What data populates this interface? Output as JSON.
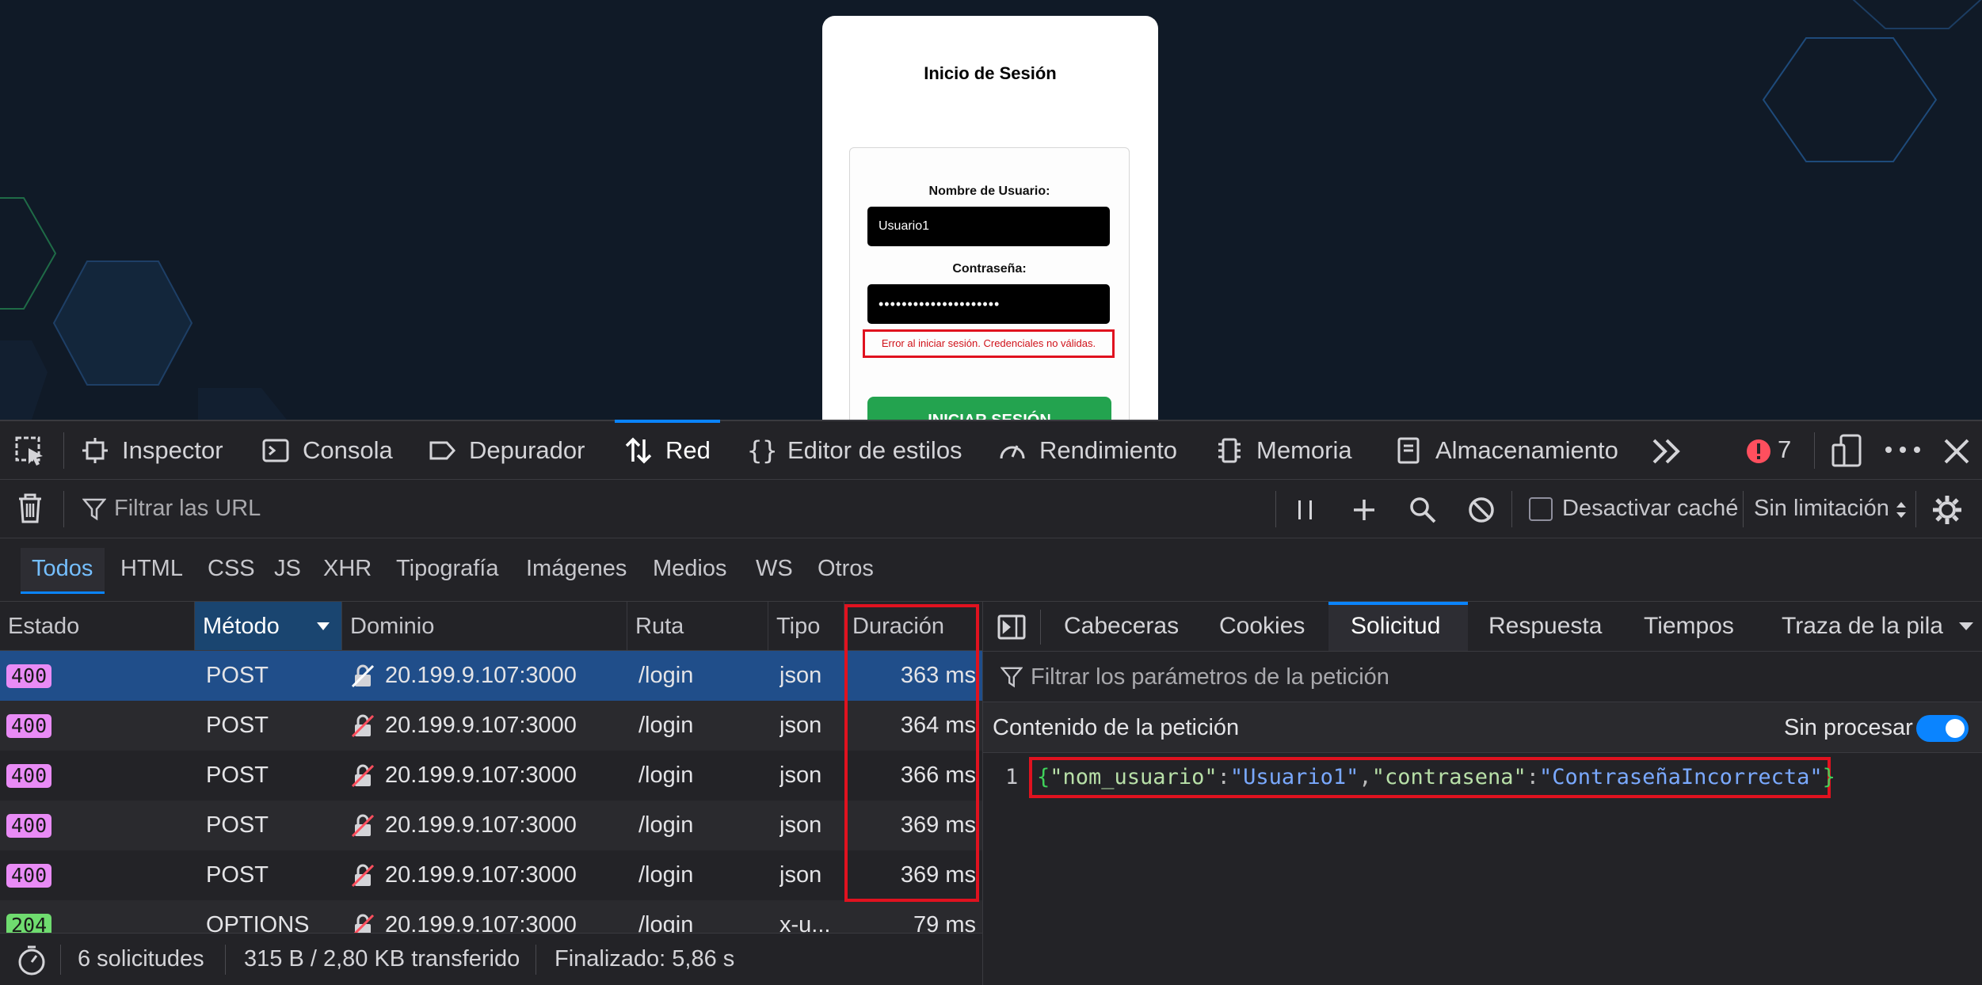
{
  "login_page": {
    "title": "Inicio de Sesión",
    "username_label": "Nombre de Usuario:",
    "username_value": "Usuario1",
    "password_label": "Contraseña:",
    "password_value": "•••••••••••••••••••••",
    "error_message": "Error al iniciar sesión. Credenciales no válidas.",
    "submit_label": "INICIAR SESIÓN"
  },
  "devtools": {
    "tabs": [
      {
        "label": "Inspector",
        "icon": "inspector-icon"
      },
      {
        "label": "Consola",
        "icon": "console-icon"
      },
      {
        "label": "Depurador",
        "icon": "debugger-icon"
      },
      {
        "label": "Red",
        "icon": "network-icon",
        "active": true
      },
      {
        "label": "Editor de estilos",
        "icon": "style-editor-icon"
      },
      {
        "label": "Rendimiento",
        "icon": "performance-icon"
      },
      {
        "label": "Memoria",
        "icon": "memory-icon"
      },
      {
        "label": "Almacenamiento",
        "icon": "storage-icon"
      }
    ],
    "error_count": "7",
    "filter_placeholder": "Filtrar las URL",
    "disable_cache_label": "Desactivar caché",
    "throttling_label": "Sin limitación",
    "type_filters": [
      "Todos",
      "HTML",
      "CSS",
      "JS",
      "XHR",
      "Tipografía",
      "Imágenes",
      "Medios",
      "WS",
      "Otros"
    ],
    "table": {
      "columns": [
        "Estado",
        "Método",
        "Dominio",
        "Ruta",
        "Tipo",
        "Duración"
      ],
      "rows": [
        {
          "status": "400",
          "method": "POST",
          "domain": "20.199.9.107:3000",
          "path": "/login",
          "type": "json",
          "duration": "363 ms"
        },
        {
          "status": "400",
          "method": "POST",
          "domain": "20.199.9.107:3000",
          "path": "/login",
          "type": "json",
          "duration": "364 ms"
        },
        {
          "status": "400",
          "method": "POST",
          "domain": "20.199.9.107:3000",
          "path": "/login",
          "type": "json",
          "duration": "366 ms"
        },
        {
          "status": "400",
          "method": "POST",
          "domain": "20.199.9.107:3000",
          "path": "/login",
          "type": "json",
          "duration": "369 ms"
        },
        {
          "status": "400",
          "method": "POST",
          "domain": "20.199.9.107:3000",
          "path": "/login",
          "type": "json",
          "duration": "369 ms"
        },
        {
          "status": "204",
          "method": "OPTIONS",
          "domain": "20.199.9.107:3000",
          "path": "/login",
          "type": "x-u...",
          "duration": "79 ms"
        }
      ]
    },
    "status_bar": {
      "requests": "6 solicitudes",
      "transferred": "315 B / 2,80 KB transferido",
      "finished": "Finalizado: 5,86 s"
    },
    "side_panel": {
      "tabs": [
        "Cabeceras",
        "Cookies",
        "Solicitud",
        "Respuesta",
        "Tiempos",
        "Traza de la pila"
      ],
      "params_filter_placeholder": "Filtrar los parámetros de la petición",
      "body_title": "Contenido de la petición",
      "raw_label": "Sin procesar",
      "line_number": "1",
      "json": {
        "k1": "\"nom_usuario\"",
        "v1": "\"Usuario1\"",
        "k2": "\"contrasena\"",
        "v2": "\"ContraseñaIncorrecta\""
      }
    }
  }
}
